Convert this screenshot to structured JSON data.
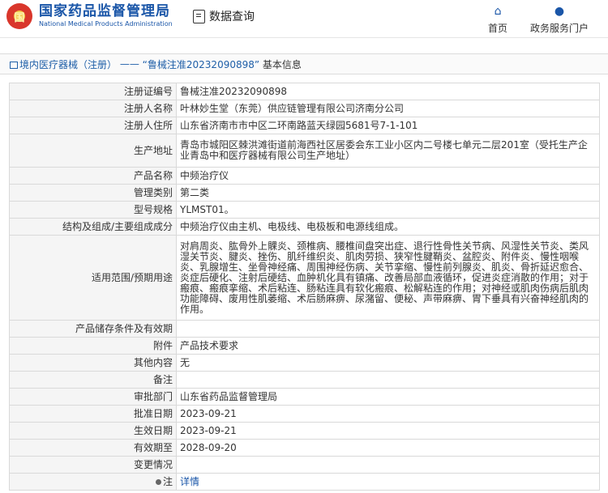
{
  "header": {
    "logo_emblem": "国",
    "site_name_cn": "国家药品监督管理局",
    "site_name_en": "National Medical Products Administration",
    "query_label": "数据查询",
    "nav": [
      {
        "label": "首页",
        "icon": "home-icon"
      },
      {
        "label": "政务服务门户",
        "icon": "user-icon"
      }
    ]
  },
  "breadcrumb": {
    "link": "境内医疗器械（注册）",
    "sep": "——",
    "title": "“鲁械注准20232090898”",
    "suffix": "基本信息"
  },
  "details": [
    {
      "label": "注册证编号",
      "value": "鲁械注准20232090898"
    },
    {
      "label": "注册人名称",
      "value": "叶林妙生堂（东莞）供应链管理有限公司济南分公司"
    },
    {
      "label": "注册人住所",
      "value": "山东省济南市市中区二环南路蓝天绿园5681号7-1-101"
    },
    {
      "label": "生产地址",
      "value": "青岛市城阳区棘洪滩街道前海西社区居委会东工业小区内二号楼七单元二层201室（受托生产企业青岛中和医疗器械有限公司生产地址）"
    },
    {
      "label": "产品名称",
      "value": "中频治疗仪"
    },
    {
      "label": "管理类别",
      "value": "第二类"
    },
    {
      "label": "型号规格",
      "value": "YLMST01。"
    },
    {
      "label": "结构及组成/主要组成成分",
      "value": "中频治疗仪由主机、电极线、电极板和电源线组成。"
    },
    {
      "label": "适用范围/预期用途",
      "value": "对肩周炎、肱骨外上髁炎、颈椎病、腰椎间盘突出症、退行性骨性关节病、风湿性关节炎、类风湿关节炎、腱炎、挫伤、肌纤维织炎、肌肉劳损、狭窄性腱鞘炎、盆腔炎、附件炎、慢性咽喉炎、乳腺增生、坐骨神经痛、周围神经伤病、关节挛缩、慢性前列腺炎、肌炎、骨折延迟愈合、炎症后硬化、注射后硬结、血肿机化具有镇痛、改善局部血液循环，促进炎症消散的作用；对于瘢痕、瘢痕挛缩、术后粘连、肠粘连具有软化瘢痕、松解粘连的作用；对神经或肌肉伤病后肌肉功能障碍、废用性肌萎缩、术后肠麻痹、尿潴留、便秘、声带麻痹、胃下垂具有兴奋神经肌肉的作用。"
    },
    {
      "label": "产品储存条件及有效期",
      "value": ""
    },
    {
      "label": "附件",
      "value": "产品技术要求"
    },
    {
      "label": "其他内容",
      "value": "无"
    },
    {
      "label": "备注",
      "value": ""
    },
    {
      "label": "审批部门",
      "value": "山东省药品监督管理局"
    },
    {
      "label": "批准日期",
      "value": "2023-09-21"
    },
    {
      "label": "生效日期",
      "value": "2023-09-21"
    },
    {
      "label": "有效期至",
      "value": "2028-09-20"
    },
    {
      "label": "变更情况",
      "value": ""
    }
  ],
  "note": {
    "label": "注",
    "link": "详情"
  }
}
